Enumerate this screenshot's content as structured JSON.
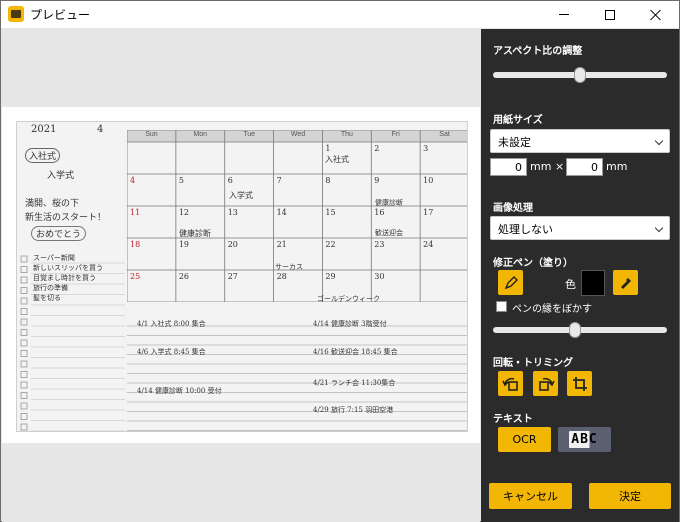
{
  "window": {
    "title": "プレビュー"
  },
  "panel": {
    "aspect": {
      "title": "アスペクト比の調整",
      "slider_value": 0.5
    },
    "paper_size": {
      "title": "用紙サイズ",
      "selected": "未設定",
      "width": "0",
      "height": "0",
      "unit1": "mm",
      "times": "×",
      "unit2": "mm"
    },
    "image_processing": {
      "title": "画像処理",
      "selected": "処理しない"
    },
    "pen": {
      "title": "修正ペン（塗り）",
      "color_label": "色",
      "color": "#000000",
      "blur_label": "ペンの縁をぼかす",
      "blur_checked": false,
      "size_value": 0.47
    },
    "rotate": {
      "title": "回転・トリミング"
    },
    "text": {
      "title": "テキスト",
      "ocr_label": "OCR",
      "abc_icon": "ABC"
    },
    "buttons": {
      "cancel": "キャンセル",
      "ok": "決定"
    }
  },
  "preview": {
    "handwriting": {
      "year": "2021",
      "month": "4",
      "note1": "入社式",
      "note2": "入学式",
      "note3": "満開、桜の下",
      "note4": "新生活のスタート！",
      "note5": "おめでとう",
      "event1": "入社式",
      "event2": "入学式",
      "event3": "健康診断",
      "event4": "健康診断",
      "event5": "サーカス",
      "event6": "歓送迎会",
      "event7": "ゴールデンウィーク",
      "list1": "スーパー新聞",
      "list2": "新しいスリッパを買う",
      "list3": "目覚まし時計を買う",
      "list4": "旅行の準備",
      "list5": "髪を切る"
    },
    "calendar": {
      "weekdays": [
        "Sun",
        "Mon",
        "Tue",
        "Wed",
        "Thu",
        "Fri",
        "Sat"
      ],
      "rows": [
        [
          "",
          "",
          "",
          "",
          "1",
          "2",
          "3"
        ],
        [
          "4",
          "5",
          "6",
          "7",
          "8",
          "9",
          "10"
        ],
        [
          "11",
          "12",
          "13",
          "14",
          "15",
          "16",
          "17"
        ],
        [
          "18",
          "19",
          "20",
          "21",
          "22",
          "23",
          "24"
        ],
        [
          "25",
          "26",
          "27",
          "28",
          "29",
          "30",
          ""
        ]
      ]
    },
    "schedule": [
      "4/1 入社式 8:00 集合",
      "4/6 入学式 8:45 集合",
      "4/14 健康診断 10:00 受付",
      "4/14 健康診断 3階受付",
      "4/16 歓送迎会 18:45 集合",
      "4/21 ランチ会 11:30集合",
      "4/29 旅行 7:15 羽田空港"
    ]
  }
}
